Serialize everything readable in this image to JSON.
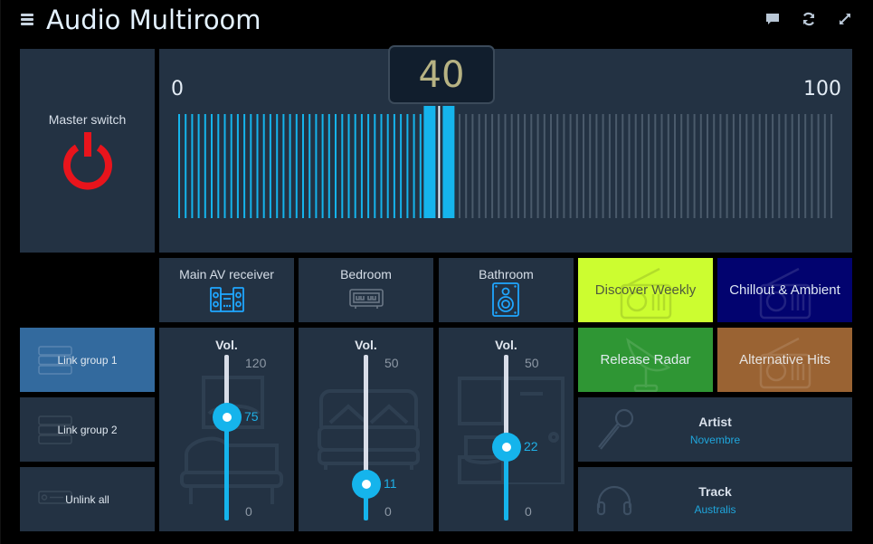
{
  "header": {
    "title": "Audio Multiroom",
    "icons": [
      "menu-icon",
      "chat-icon",
      "refresh-icon",
      "fullscreen-icon"
    ]
  },
  "master": {
    "label": "Master switch",
    "state": "off",
    "icon": "power-icon",
    "color": "#e8141c"
  },
  "master_volume": {
    "value": 40,
    "display": "40",
    "min": 0,
    "max": 100,
    "min_label": "0",
    "max_label": "100",
    "active_color": "#15b4ec",
    "inactive_color": "#4a5a6b",
    "value_color": "#b7b383"
  },
  "devices": [
    {
      "label": "Main AV receiver",
      "icon": "stereo-system-icon",
      "active": true
    },
    {
      "label": "Bedroom",
      "icon": "alarm-clock-icon",
      "active": false
    },
    {
      "label": "Bathroom",
      "icon": "speaker-icon",
      "active": true
    }
  ],
  "groups": [
    {
      "label": "Link group 1",
      "icon": "server-stack-icon",
      "active": true
    },
    {
      "label": "Link group 2",
      "icon": "server-stack-icon",
      "active": false
    },
    {
      "label": "Unlink all",
      "icon": "receiver-icon",
      "active": false
    }
  ],
  "room_volumes": [
    {
      "label": "Vol.",
      "value": 75,
      "value_label": "75",
      "min": 0,
      "max": 120,
      "min_label": "0",
      "max_label": "120",
      "bg_icon": "living-room-icon"
    },
    {
      "label": "Vol.",
      "value": 11,
      "value_label": "11",
      "min": 0,
      "max": 50,
      "min_label": "0",
      "max_label": "50",
      "bg_icon": "bed-icon"
    },
    {
      "label": "Vol.",
      "value": 22,
      "value_label": "22",
      "min": 0,
      "max": 50,
      "min_label": "0",
      "max_label": "50",
      "bg_icon": "bathroom-icon"
    }
  ],
  "playlists": [
    {
      "label": "Discover Weekly",
      "bg": "#ccfd30",
      "fg": "#4f5a3e",
      "icon": "radio-icon"
    },
    {
      "label": "Chillout & Ambient",
      "bg": "#02036f",
      "fg": "#dde6f3",
      "icon": "radio-icon"
    },
    {
      "label": "Release Radar",
      "bg": "#2f9634",
      "fg": "#e1ecef",
      "icon": "satellite-dish-icon"
    },
    {
      "label": "Alternative Hits",
      "bg": "#9a6333",
      "fg": "#e6e3e0",
      "icon": "radio-icon"
    }
  ],
  "now_playing": {
    "artist_label": "Artist",
    "artist": "Novembre",
    "track_label": "Track",
    "track": "Australis"
  }
}
